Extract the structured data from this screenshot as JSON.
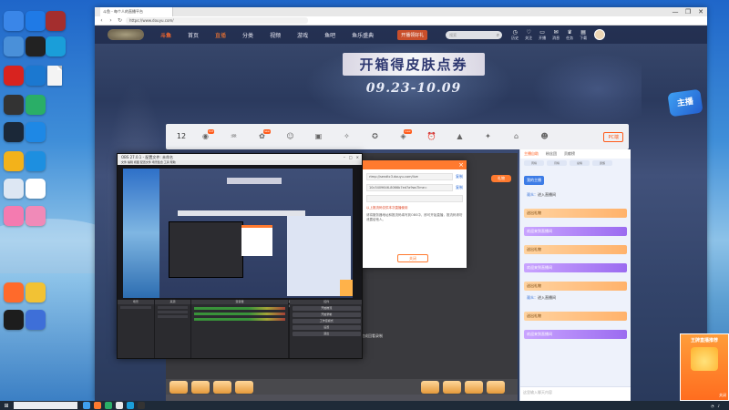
{
  "desktop": {
    "icons": [
      {
        "icon": "app-blue-icon",
        "label": "",
        "color": "#3a86e8"
      },
      {
        "icon": "tencent-video-icon",
        "label": "",
        "color": "#1f7ae6"
      },
      {
        "icon": "game-icon",
        "label": "",
        "color": "#a42e2e"
      },
      {
        "icon": "pc-icon",
        "label": "",
        "color": "#4a90d9"
      },
      {
        "icon": "screen-recorder-icon",
        "label": "",
        "color": "#222222"
      },
      {
        "icon": "edge-icon",
        "label": "",
        "color": "#1a9ed9"
      },
      {
        "icon": "file-icon",
        "label": "",
        "color": "#f0f0f0"
      },
      {
        "icon": "search-app-icon",
        "label": "",
        "color": "#1b78d0"
      },
      {
        "icon": "netease-music-icon",
        "label": "",
        "color": "#d8231f"
      },
      {
        "icon": "obs-icon",
        "label": "",
        "color": "#333333"
      },
      {
        "icon": "wechat-icon",
        "label": "",
        "color": "#2aae67"
      },
      {
        "icon": "steam-icon",
        "label": "",
        "color": "#1b2838"
      },
      {
        "icon": "xunlei-icon",
        "label": "",
        "color": "#1e88e5"
      },
      {
        "icon": "tool-icon",
        "label": "",
        "color": "#f3b21a"
      },
      {
        "icon": "weather-icon",
        "label": "",
        "color": "#1d8fe0"
      },
      {
        "icon": "blank-icon",
        "label": "",
        "color": "#dde7f3"
      },
      {
        "icon": "cat-icon",
        "label": "",
        "color": "#ffffff"
      },
      {
        "icon": "pink-app-icon",
        "label": "",
        "color": "#f47bb0"
      },
      {
        "icon": "heart-app-icon",
        "label": "",
        "color": "#f08ab8"
      },
      {
        "icon": "douyu-icon",
        "label": "",
        "color": "#ff6a2b"
      },
      {
        "icon": "owl-icon",
        "label": "",
        "color": "#f2c234"
      },
      {
        "icon": "qq-icon",
        "label": "",
        "color": "#1d1d1d"
      },
      {
        "icon": "star-game-icon",
        "label": "",
        "color": "#3e6fd8"
      }
    ]
  },
  "browser": {
    "tab_title": "斗鱼 - 每个人的直播平台",
    "url": "https://www.douyu.com/",
    "window_controls": [
      "—",
      "❐",
      "✕"
    ]
  },
  "site": {
    "brand": "斗鱼",
    "nav": [
      "首页",
      "直播",
      "分类",
      "视频",
      "游戏",
      "鱼吧",
      "鱼乐盛典"
    ],
    "nav_active": "直播",
    "promo": "开播领好礼",
    "search_placeholder": "搜索",
    "top_icons": [
      {
        "glyph": "◷",
        "label": "历史"
      },
      {
        "glyph": "♡",
        "label": "关注"
      },
      {
        "glyph": "▭",
        "label": "开播"
      },
      {
        "glyph": "✉",
        "label": "消息"
      },
      {
        "glyph": "♛",
        "label": "任务"
      },
      {
        "glyph": "▤",
        "label": "下载"
      }
    ],
    "banner_title": "开箱得皮肤点券",
    "banner_date": "09.23-10.09",
    "gift_logo": "主播",
    "room_bar": {
      "count": "12",
      "count_label": "",
      "items": [
        {
          "glyph": "◉",
          "label": "礼物",
          "badge": "hot"
        },
        {
          "glyph": "♒",
          "label": "",
          "badge": ""
        },
        {
          "glyph": "✿",
          "label": "",
          "badge": "new"
        },
        {
          "glyph": "☺",
          "label": "",
          "badge": ""
        },
        {
          "glyph": "▣",
          "label": "",
          "badge": ""
        },
        {
          "glyph": "✧",
          "label": "",
          "badge": ""
        },
        {
          "glyph": "✪",
          "label": "",
          "badge": ""
        },
        {
          "glyph": "◈",
          "label": "",
          "badge": "new"
        },
        {
          "glyph": "⏰",
          "label": "",
          "badge": ""
        },
        {
          "glyph": "▲",
          "label": "",
          "badge": ""
        },
        {
          "glyph": "✦",
          "label": "",
          "badge": ""
        },
        {
          "glyph": "⌂",
          "label": "",
          "badge": ""
        },
        {
          "glyph": "☻",
          "label": "",
          "badge": ""
        }
      ],
      "report": "PC端"
    },
    "video_note": "完成回看录制",
    "video_note2": "播放",
    "chat": {
      "tabs": [
        "主播自助",
        "粉丝团",
        "贡献榜"
      ],
      "rank": [
        "周榜",
        "月榜",
        "总榜",
        "贵族"
      ],
      "messages": [
        {
          "type": "tag",
          "text": "我的主播"
        },
        {
          "type": "normal",
          "user": "观众",
          "text": "进入直播间"
        },
        {
          "type": "gift",
          "text": "送出礼物"
        },
        {
          "type": "purple",
          "text": "欢迎来到直播间"
        },
        {
          "type": "gift",
          "text": "送出礼物"
        },
        {
          "type": "purple",
          "text": "欢迎来到直播间"
        },
        {
          "type": "gift",
          "text": "送出礼物"
        },
        {
          "type": "normal",
          "user": "观众",
          "text": "进入直播间"
        },
        {
          "type": "gift",
          "text": "送出礼物"
        },
        {
          "type": "purple",
          "text": "欢迎来到直播间"
        }
      ],
      "input_placeholder": "这里输入聊天内容"
    }
  },
  "obs": {
    "title": "OBS 27.0.1 - 配置文件: 未命名",
    "menu": "文件 编辑 视图 配置文件 场景集合 工具 帮助",
    "docks": [
      "场景",
      "来源",
      "混音器",
      "转场",
      "控件"
    ],
    "controls": [
      "开始推流",
      "开始录制",
      "工作室模式",
      "设置",
      "退出"
    ]
  },
  "dialog": {
    "server_label": "rtmp://sendtc3.douyu.com/live",
    "key_label": "10c3409646-8066b7ed7a9wsTime=",
    "copy": "复制",
    "warning": "以上推流码仅供本次直播使用",
    "tips": "请将服务器地址和推流码填写到OBS中，即可开始直播，推流码请勿泄露给他人。",
    "ok": "关闭"
  },
  "ad": {
    "title": "王牌直播推荐",
    "close": "关闭"
  },
  "taskbar": {
    "search": "",
    "tray_time": "",
    "apps": [
      "#3fa0f0",
      "#ff7a2f",
      "#2aae67",
      "#e8e8e8",
      "#1a9ed9",
      "#333333"
    ]
  }
}
